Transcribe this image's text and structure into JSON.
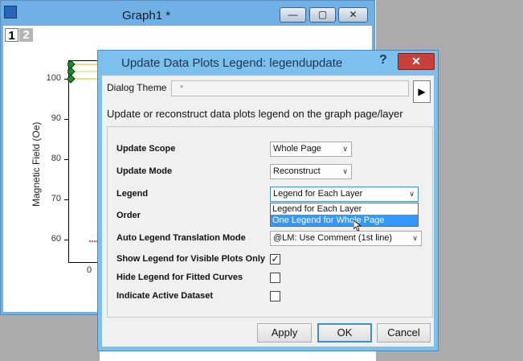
{
  "graph_window": {
    "title": "Graph1 *",
    "layer_tabs": [
      "1",
      "2"
    ],
    "y_axis_label": "Magnetic Field (Oe)",
    "y_ticks": [
      "100",
      "90",
      "80",
      "70",
      "60"
    ],
    "x_ticks": [
      "0"
    ]
  },
  "dialog": {
    "title": "Update Data Plots Legend: legendupdate",
    "help_label": "?",
    "close_label": "✕",
    "theme_label": "Dialog Theme",
    "theme_value": "*",
    "description": "Update or reconstruct data plots legend on the graph page/layer",
    "rows": [
      {
        "label": "Update Scope",
        "value": "Whole Page"
      },
      {
        "label": "Update Mode",
        "value": "Reconstruct"
      },
      {
        "label": "Legend",
        "value": "Legend for Each Layer"
      },
      {
        "label": "Order",
        "value": ""
      },
      {
        "label": "Auto Legend Translation Mode",
        "value": "@LM: Use Comment (1st line)"
      }
    ],
    "legend_dropdown_options": [
      "Legend for Each Layer",
      "One Legend for Whole Page"
    ],
    "legend_highlighted_option": "One Legend for Whole Page",
    "checkboxes": [
      {
        "label": "Show Legend for Visible Plots Only",
        "checked": true,
        "mark": "✓"
      },
      {
        "label": "Hide Legend for Fitted Curves",
        "checked": false,
        "mark": ""
      },
      {
        "label": "Indicate Active Dataset",
        "checked": false,
        "mark": ""
      }
    ],
    "buttons": {
      "apply": "Apply",
      "ok": "OK",
      "cancel": "Cancel"
    }
  }
}
